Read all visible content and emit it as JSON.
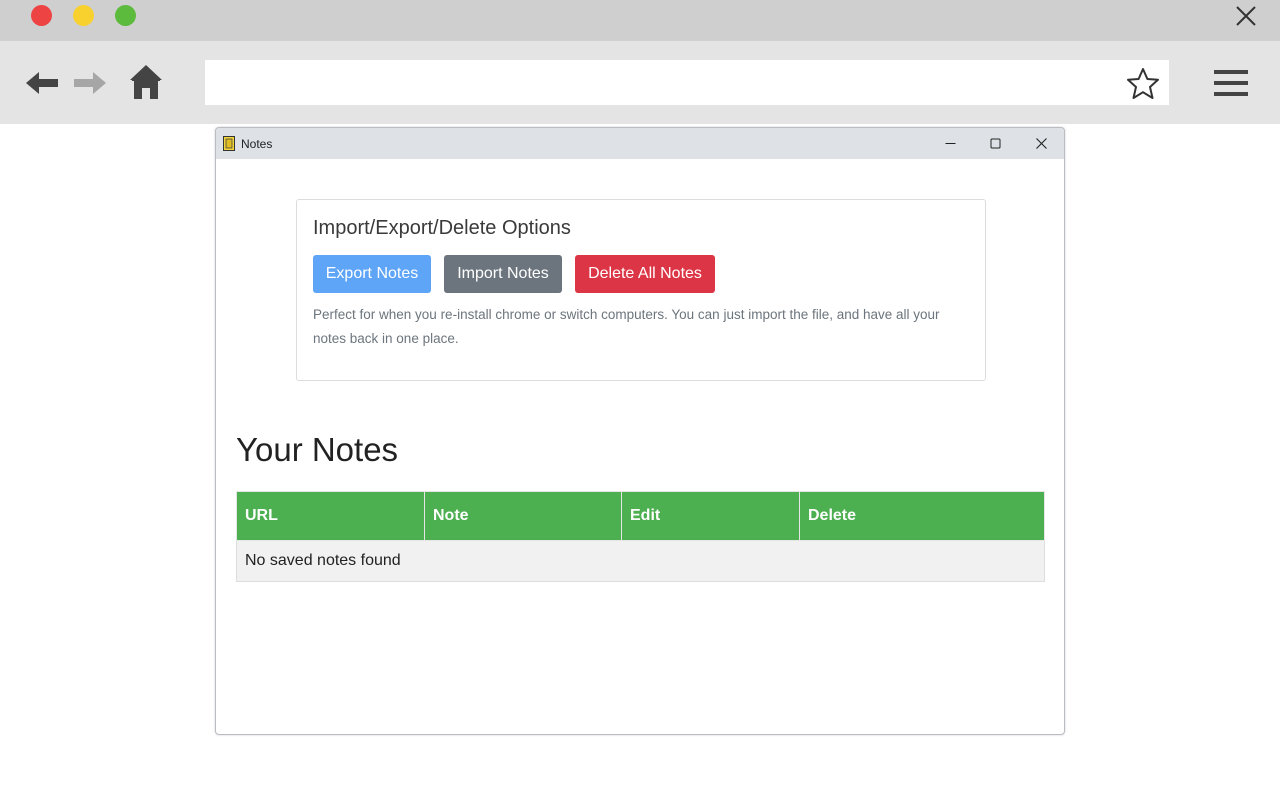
{
  "browser": {
    "address_value": "",
    "icons": [
      "close-icon",
      "back-arrow-icon",
      "forward-arrow-icon",
      "home-icon",
      "star-icon",
      "hamburger-menu-icon"
    ]
  },
  "popup": {
    "title": "Notes",
    "icons": [
      "notes-app-icon",
      "minimize-icon",
      "maximize-icon",
      "close-icon"
    ]
  },
  "options": {
    "title": "Import/Export/Delete Options",
    "export_label": "Export Notes",
    "import_label": "Import Notes",
    "delete_label": "Delete All Notes",
    "description": "Perfect for when you re-install chrome or switch computers. You can just import the file, and have all your notes back in one place.",
    "colors": {
      "export": "#5ea4f7",
      "import": "#6c757d",
      "delete": "#dc3545"
    }
  },
  "notes": {
    "heading": "Your Notes",
    "columns": [
      "URL",
      "Note",
      "Edit",
      "Delete"
    ],
    "empty_message": "No saved notes found",
    "header_color": "#4caf50"
  }
}
